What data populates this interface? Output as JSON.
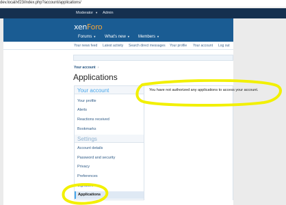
{
  "browser": {
    "url": "dev.local/xf23/index.php?account/applications/"
  },
  "top_bar": {
    "moderator_label": "Moderator",
    "admin_label": "Admin"
  },
  "logo": {
    "text_main": "xen",
    "text_accent": "Foro"
  },
  "nav": {
    "tabs": [
      {
        "label": "Forums"
      },
      {
        "label": "What's new"
      },
      {
        "label": "Members"
      }
    ]
  },
  "subnav": {
    "links": [
      {
        "label": "Your news feed"
      },
      {
        "label": "Latest activity"
      },
      {
        "label": "Search direct messages"
      },
      {
        "label": "Your profile"
      },
      {
        "label": "Your account"
      },
      {
        "label": "Log out"
      }
    ]
  },
  "breadcrumb": {
    "item": "Your account",
    "separator": "›"
  },
  "page": {
    "title": "Applications"
  },
  "sidebar": {
    "account_heading": "Your account",
    "account_items": [
      {
        "label": "Your profile"
      },
      {
        "label": "Alerts"
      },
      {
        "label": "Reactions received"
      },
      {
        "label": "Bookmarks"
      }
    ],
    "settings_heading": "Settings",
    "settings_items": [
      {
        "label": "Account details"
      },
      {
        "label": "Password and security"
      },
      {
        "label": "Privacy"
      },
      {
        "label": "Preferences"
      },
      {
        "label": "Signature"
      }
    ],
    "active_item": "Applications"
  },
  "content": {
    "message": "You have not authorized any applications to access your account."
  },
  "colors": {
    "header_blue": "#1a5c93",
    "topbar_navy": "#15304f",
    "sidebar_heading_accent": "#47a7eb",
    "link_blue": "#2e5a86",
    "highlight_yellow": "#f2f000"
  }
}
